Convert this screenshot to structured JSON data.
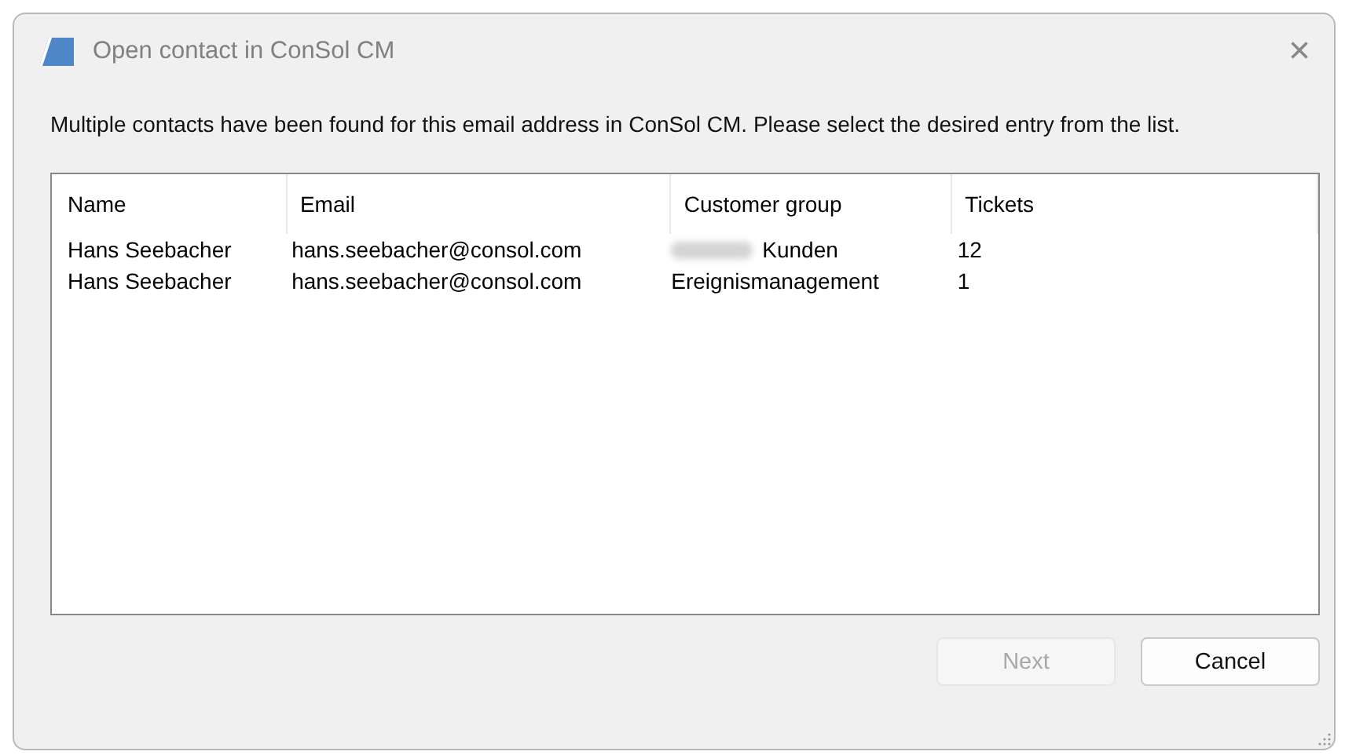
{
  "window": {
    "title": "Open contact in ConSol CM",
    "close": "×"
  },
  "message": "Multiple contacts have been found for this email address in ConSol CM. Please select the desired entry from the list.",
  "table": {
    "columns": [
      "Name",
      "Email",
      "Customer group",
      "Tickets"
    ],
    "rows": [
      {
        "cells": [
          "Hans Seebacher",
          "hans.seebacher@consol.com",
          "Kunden",
          "12"
        ],
        "redacted": true
      },
      {
        "cells": [
          "Hans Seebacher",
          "hans.seebacher@consol.com",
          "Ereignismanagement",
          "1"
        ],
        "redacted": false
      }
    ]
  },
  "buttons": [
    {
      "label": "Next",
      "disabled": true
    },
    {
      "label": "Cancel",
      "disabled": false
    }
  ]
}
